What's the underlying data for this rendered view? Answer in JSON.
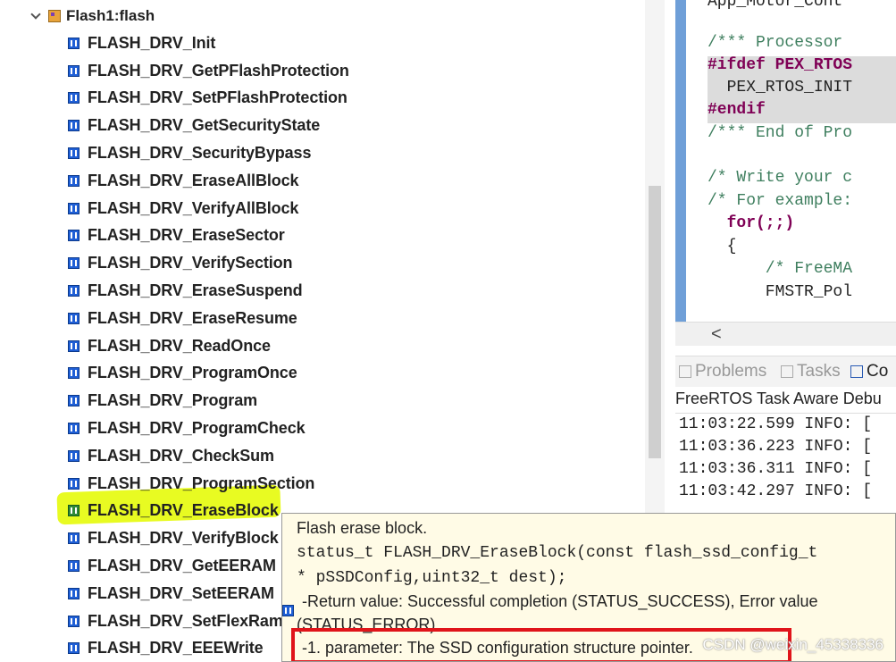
{
  "tree": {
    "root_label": "Flash1:flash",
    "items": [
      {
        "label": "FLASH_DRV_Init"
      },
      {
        "label": "FLASH_DRV_GetPFlashProtection"
      },
      {
        "label": "FLASH_DRV_SetPFlashProtection"
      },
      {
        "label": "FLASH_DRV_GetSecurityState"
      },
      {
        "label": "FLASH_DRV_SecurityBypass"
      },
      {
        "label": "FLASH_DRV_EraseAllBlock"
      },
      {
        "label": "FLASH_DRV_VerifyAllBlock"
      },
      {
        "label": "FLASH_DRV_EraseSector"
      },
      {
        "label": "FLASH_DRV_VerifySection"
      },
      {
        "label": "FLASH_DRV_EraseSuspend"
      },
      {
        "label": "FLASH_DRV_EraseResume"
      },
      {
        "label": "FLASH_DRV_ReadOnce"
      },
      {
        "label": "FLASH_DRV_ProgramOnce"
      },
      {
        "label": "FLASH_DRV_Program"
      },
      {
        "label": "FLASH_DRV_ProgramCheck"
      },
      {
        "label": "FLASH_DRV_CheckSum"
      },
      {
        "label": "FLASH_DRV_ProgramSection"
      },
      {
        "label": "FLASH_DRV_EraseBlock"
      },
      {
        "label": "FLASH_DRV_VerifyBlock"
      },
      {
        "label": "FLASH_DRV_GetEERAM"
      },
      {
        "label": "FLASH_DRV_SetEERAM"
      },
      {
        "label": "FLASH_DRV_SetFlexRam"
      },
      {
        "label": "FLASH_DRV_EEEWrite"
      }
    ],
    "highlighted_index": 17
  },
  "editor": {
    "lines": [
      {
        "text": "App_Motor_Cont",
        "kind": "normal"
      },
      {
        "text": "/*** Processor",
        "kind": "comment"
      },
      {
        "text": "#ifdef PEX_RTOS",
        "kind": "directive"
      },
      {
        "text": "  PEX_RTOS_INIT",
        "kind": "normal"
      },
      {
        "text": "#endif",
        "kind": "directive"
      },
      {
        "text": "/*** End of Pro",
        "kind": "comment"
      },
      {
        "text": "/* Write your c",
        "kind": "comment"
      },
      {
        "text": "/* For example:",
        "kind": "comment"
      },
      {
        "text": "  for(;;)",
        "kind": "keyword"
      },
      {
        "text": "  {",
        "kind": "normal"
      },
      {
        "text": "      /* FreeMA",
        "kind": "comment"
      },
      {
        "text": "      FMSTR_Pol",
        "kind": "normal"
      }
    ],
    "scroll_left_glyph": "<"
  },
  "console": {
    "tabs": [
      {
        "label": "Problems",
        "active": false
      },
      {
        "label": "Tasks",
        "active": false
      },
      {
        "label": "Co",
        "active": true
      }
    ],
    "title": "FreeRTOS Task Aware Debu",
    "log_lines": [
      "11:03:22.599 INFO: [",
      "11:03:36.223 INFO: [",
      "11:03:36.311 INFO: [",
      "11:03:42.297 INFO: ["
    ]
  },
  "tooltip": {
    "title": "Flash erase block.",
    "signature_line1": "status_t FLASH_DRV_EraseBlock(const flash_ssd_config_t",
    "signature_line2": "* pSSDConfig,uint32_t dest);",
    "return_line": "-Return value: Successful completion (STATUS_SUCCESS), Error value",
    "return_line2": "(STATUS_ERROR)",
    "param_line": "-1. parameter: The SSD configuration structure pointer."
  },
  "watermark": "CSDN @weixin_45338336",
  "colors": {
    "highlight_yellow": "#e8fb22",
    "annotation_red": "#e0141a",
    "method_icon_blue": "#1f5fd6",
    "comment_green": "#3f7f5f",
    "keyword_purple": "#7f0055"
  }
}
